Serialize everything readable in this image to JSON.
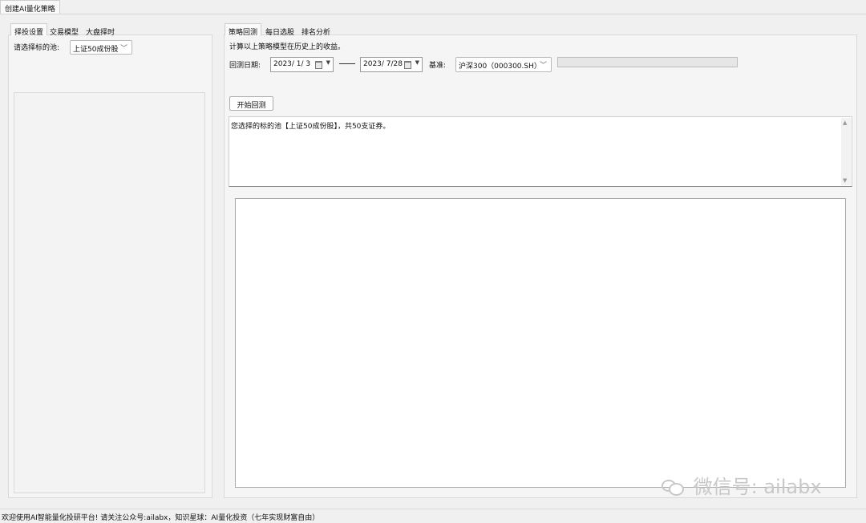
{
  "window": {
    "top_tab": "创建AI量化策略"
  },
  "left_panel": {
    "tabs": [
      "择投设置",
      "交易模型",
      "大盘择时"
    ],
    "pool_label": "请选择标的池:",
    "pool_value": "上证50成份股"
  },
  "right_panel": {
    "tabs": [
      "策略回测",
      "每日选股",
      "排名分析"
    ],
    "description": "计算以上策略模型在历史上的收益。",
    "date_label": "回测日期:",
    "start_date": "2023/ 1/ 3",
    "end_date": "2023/ 7/28",
    "benchmark_label": "基准:",
    "benchmark_value": "沪深300（000300.SH）",
    "start_button": "开始回测",
    "log_text": "您选择的标的池【上证50成份股】，共50支证券。"
  },
  "watermark": "微信号: ailabx",
  "status_text": "欢迎使用AI智能量化投研平台! 请关注公众号:ailabx，知识星球：AI量化投资（七年实现财富自由）"
}
